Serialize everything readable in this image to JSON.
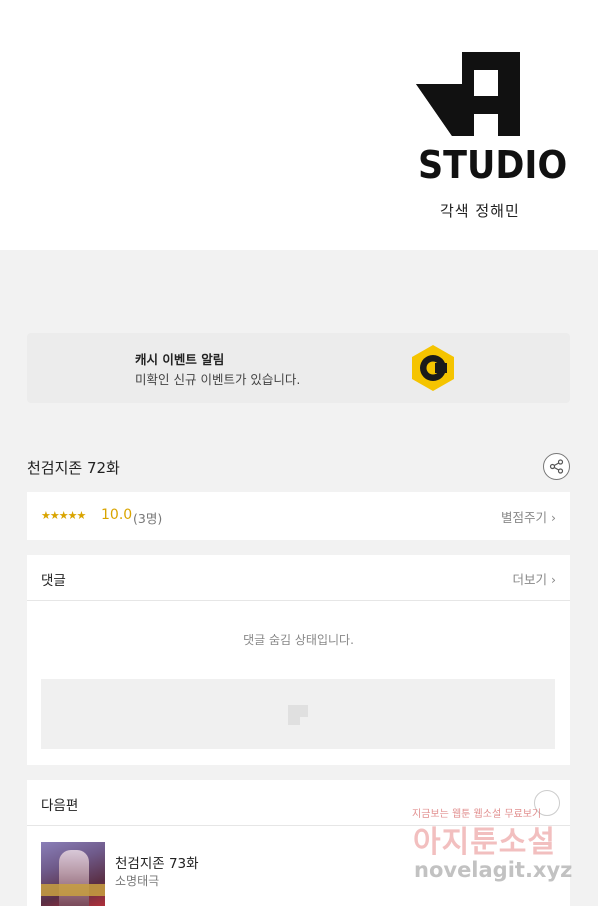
{
  "hero": {
    "studio_text": "STUDIO",
    "credit": "각색 정해민"
  },
  "cash_banner": {
    "title": "캐시 이벤트 알림",
    "subtitle": "미확인 신규 이벤트가 있습니다.",
    "icon": "cash-coin-icon",
    "coin_color": "#f5c400",
    "coin_letter": "C"
  },
  "episode": {
    "title": "천검지존 72화",
    "share_icon": "share-icon"
  },
  "rating": {
    "stars": "★★★★★",
    "score": "10.0",
    "count": "(3명)",
    "action_label": "별점주기",
    "star_color": "#d9a400"
  },
  "comments": {
    "heading": "댓글",
    "more_label": "더보기",
    "hidden_message": "댓글 숨김 상태입니다."
  },
  "next": {
    "heading": "다음편",
    "item": {
      "title": "천검지존 73화",
      "author": "소명태극"
    }
  },
  "watermark": {
    "tagline": "지금보는 웹툰 웹소설 무료보기",
    "name": "아지툰소설",
    "url": "novelagit.xyz"
  }
}
